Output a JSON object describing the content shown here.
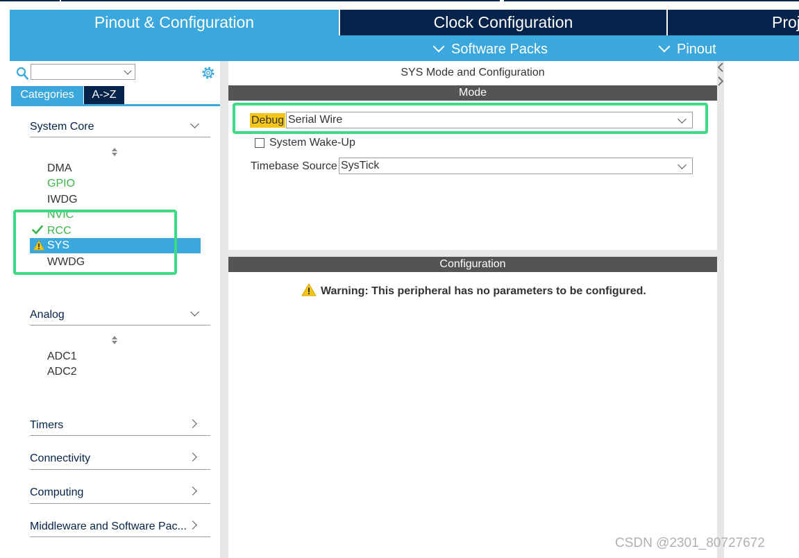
{
  "tabs": {
    "pinout": "Pinout & Configuration",
    "clock": "Clock Configuration",
    "project": "Project Manager"
  },
  "submenu": {
    "software_packs": "Software Packs",
    "pinout": "Pinout"
  },
  "sidebar": {
    "search_value": "",
    "tab_categories": "Categories",
    "tab_az": "A->Z",
    "sections": [
      {
        "label": "System Core",
        "expanded": true,
        "items": [
          "DMA",
          "GPIO",
          "IWDG",
          "NVIC",
          "RCC",
          "SYS",
          "WWDG"
        ]
      },
      {
        "label": "Analog",
        "expanded": true,
        "items": [
          "ADC1",
          "ADC2"
        ]
      },
      {
        "label": "Timers",
        "expanded": false
      },
      {
        "label": "Connectivity",
        "expanded": false
      },
      {
        "label": "Computing",
        "expanded": false
      },
      {
        "label": "Middleware and Software Pac...",
        "expanded": false
      }
    ],
    "selected_item": "SYS"
  },
  "main": {
    "title": "SYS Mode and Configuration",
    "mode_header": "Mode",
    "debug_label": "Debug",
    "debug_value": "Serial Wire",
    "wakeup_label": "System Wake-Up",
    "wakeup_checked": false,
    "timebase_label": "Timebase Source",
    "timebase_value": "SysTick",
    "config_header": "Configuration",
    "warning_text": "Warning: This peripheral has no parameters to be configured."
  },
  "watermark": "CSDN @2301_80727672",
  "colors": {
    "navy": "#03234b",
    "accent_blue": "#3aa8dc",
    "ok_green": "#3ab549",
    "warning_yellow": "#f5c518",
    "highlight_green": "#3ddc84",
    "section_bar": "#545454"
  }
}
